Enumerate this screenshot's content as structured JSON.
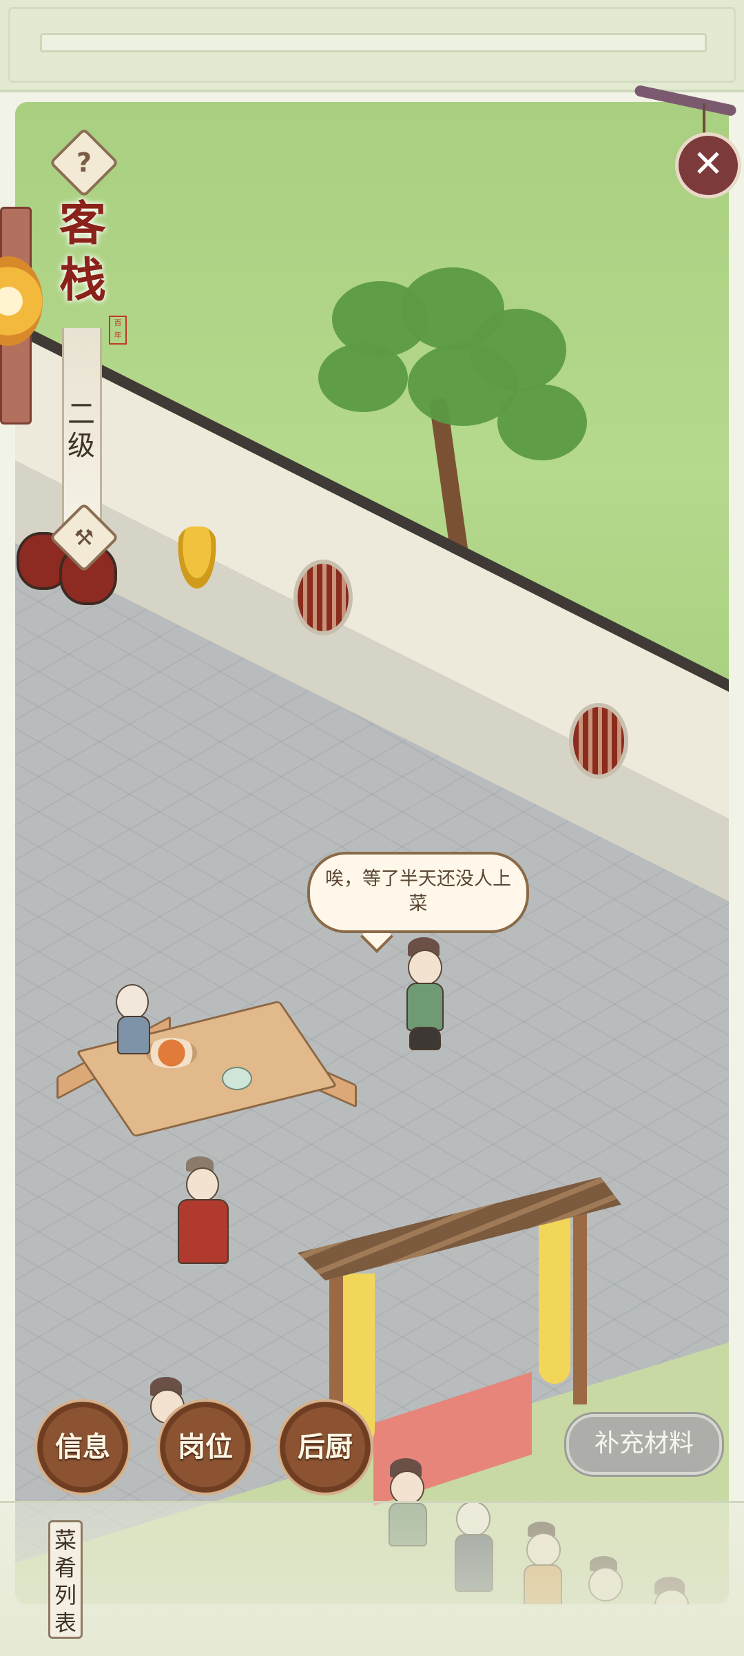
{
  "header": {
    "title": "客栈",
    "title_chars": [
      "客",
      "栈"
    ],
    "level": "二级",
    "help_symbol": "?",
    "close_symbol": "✕",
    "hammer_symbol": "⚒"
  },
  "dialog": {
    "speech_text": "唉，等了半天还没人上菜"
  },
  "buttons": {
    "info": "信息",
    "post": "岗位",
    "kitchen": "后厨",
    "supplement": "补充材料"
  },
  "menu_tab": {
    "label": "菜肴列表"
  },
  "icons": {
    "help": "help-icon",
    "close": "close-icon",
    "upgrade": "hammer-icon"
  },
  "colors": {
    "title_red": "#8a2219",
    "button_brown": "#8b5332",
    "supplement_gray": "#adaeaa"
  }
}
